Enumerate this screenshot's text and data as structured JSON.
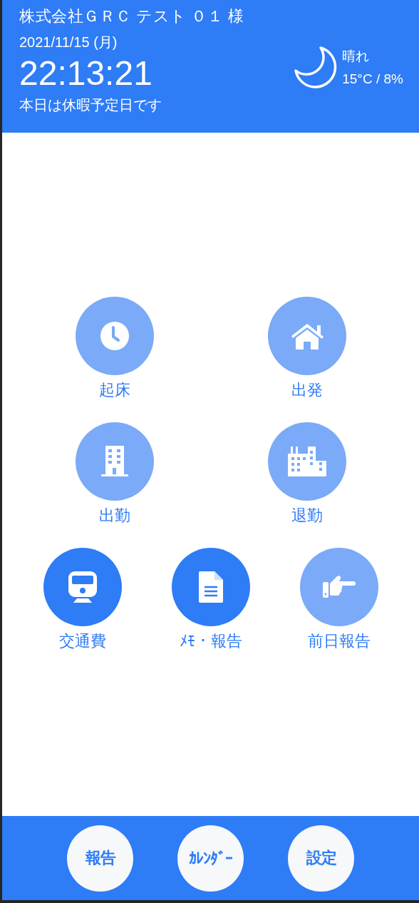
{
  "header": {
    "account": "株式会社ＧＲＣ テスト ０１ 様",
    "date": "2021/11/15 (月)",
    "time": "22:13:21",
    "notice": "本日は休暇予定日です",
    "weather": {
      "condition": "晴れ",
      "reading": "15°C / 8%"
    }
  },
  "actions": [
    [
      {
        "label": "起床",
        "kind": "clock",
        "enabled": false
      },
      {
        "label": "出発",
        "kind": "house",
        "enabled": false
      }
    ],
    [
      {
        "label": "出勤",
        "kind": "building",
        "enabled": false
      },
      {
        "label": "退勤",
        "kind": "city",
        "enabled": false
      }
    ],
    [
      {
        "label": "交通費",
        "kind": "train",
        "enabled": true
      },
      {
        "label": "ﾒﾓ・報告",
        "kind": "document",
        "enabled": true
      },
      {
        "label": "前日報告",
        "kind": "hand",
        "enabled": false
      }
    ]
  ],
  "bottom_nav": [
    "報告",
    "ｶﾚﾝﾀﾞｰ",
    "設定"
  ]
}
